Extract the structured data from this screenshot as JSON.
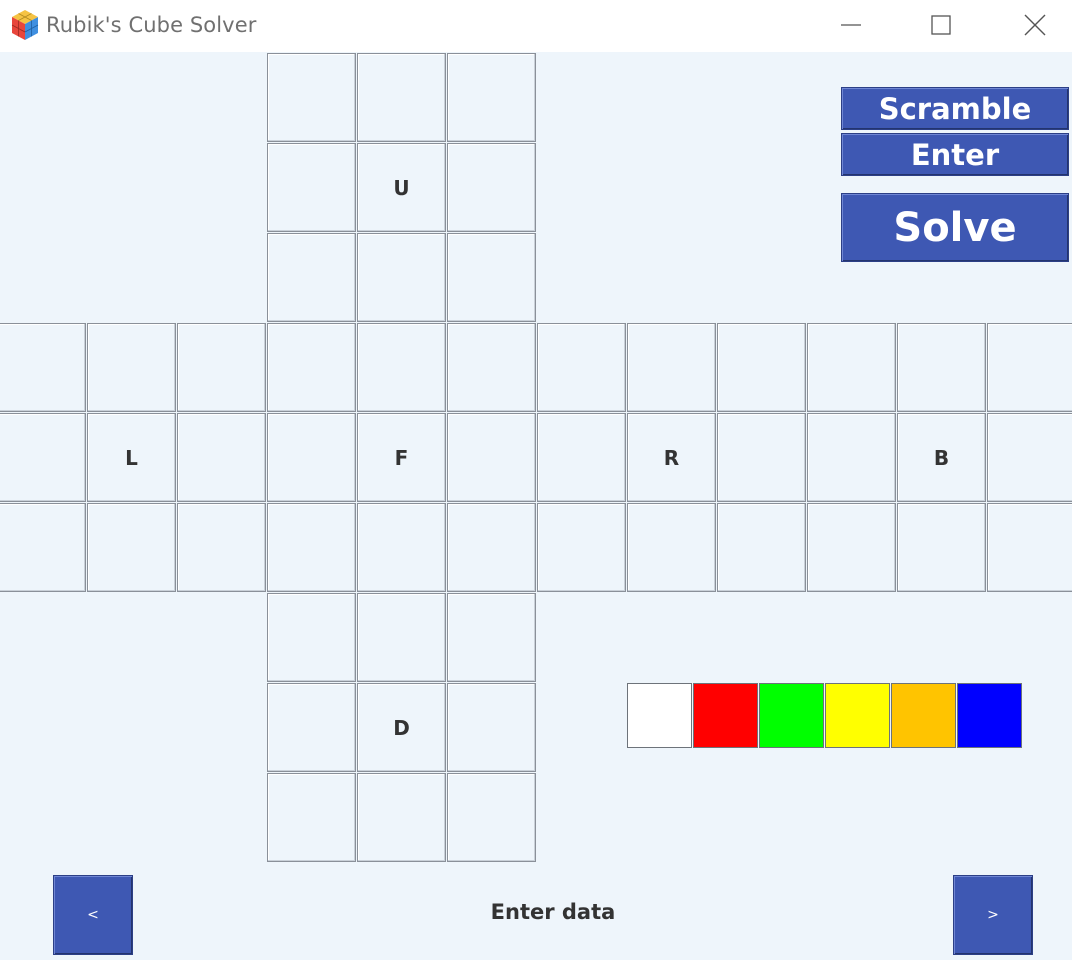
{
  "window": {
    "title": "Rubik's Cube Solver",
    "minimize_label": "—",
    "maximize_label": "☐",
    "close_label": "✕"
  },
  "buttons": {
    "scramble": "Scramble",
    "enter": "Enter",
    "solve": "Solve",
    "prev": "<",
    "next": ">"
  },
  "faces": {
    "U": "U",
    "L": "L",
    "F": "F",
    "R": "R",
    "B": "B",
    "D": "D"
  },
  "palette": [
    {
      "name": "white",
      "color": "#ffffff"
    },
    {
      "name": "red",
      "color": "#ff0000"
    },
    {
      "name": "green",
      "color": "#00ff00"
    },
    {
      "name": "yellow",
      "color": "#ffff00"
    },
    {
      "name": "orange",
      "color": "#ffc400"
    },
    {
      "name": "blue",
      "color": "#0000ff"
    }
  ],
  "status": {
    "text": "Enter data"
  }
}
